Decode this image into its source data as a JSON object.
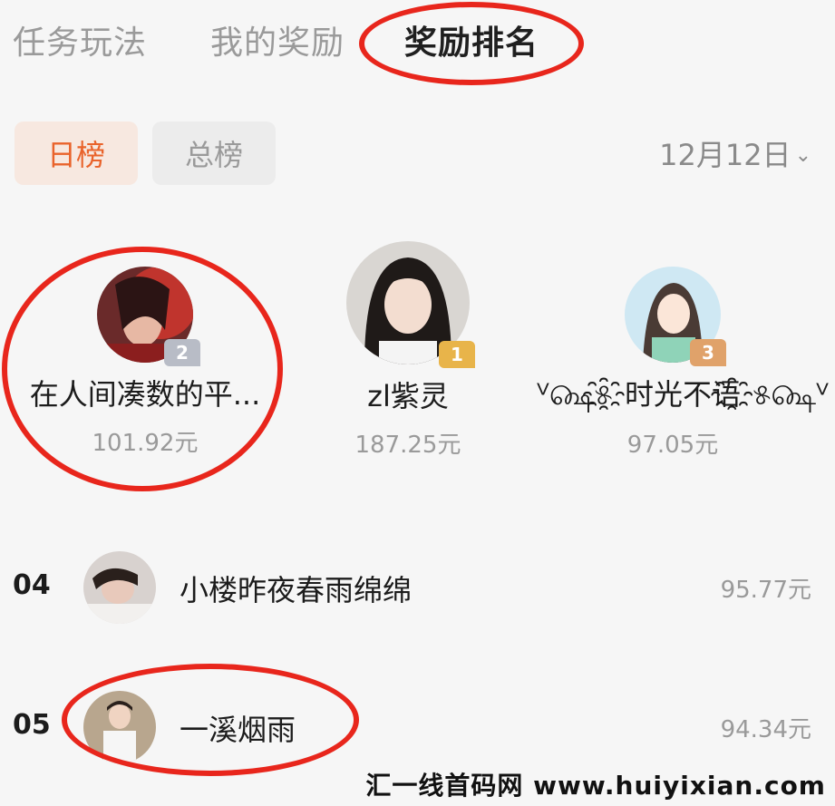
{
  "tabs": [
    {
      "label": "任务玩法"
    },
    {
      "label": "我的奖励"
    },
    {
      "label": "奖励排名"
    }
  ],
  "filters": {
    "daily": "日榜",
    "total": "总榜",
    "date": "12月12日"
  },
  "podium": [
    {
      "rank": "2",
      "name": "在人间凑数的平...",
      "amount": "101.92元"
    },
    {
      "rank": "1",
      "name": "zl紫灵",
      "amount": "187.25元"
    },
    {
      "rank": "3",
      "name": "ⱽ௸୫҈时光不语҈୫௸ⱽ",
      "amount": "97.05元"
    }
  ],
  "list": [
    {
      "rank": "04",
      "name": "小楼昨夜春雨绵绵",
      "amount": "95.77元"
    },
    {
      "rank": "05",
      "name": "一溪烟雨",
      "amount": "94.34元"
    }
  ],
  "watermark": "汇一线首码网 www.huiyixian.com",
  "colors": {
    "accent": "#e9632b",
    "annotation": "#e8261c",
    "gold": "#e8b44a",
    "silver": "#b8bcc6",
    "bronze": "#e0a26a"
  }
}
